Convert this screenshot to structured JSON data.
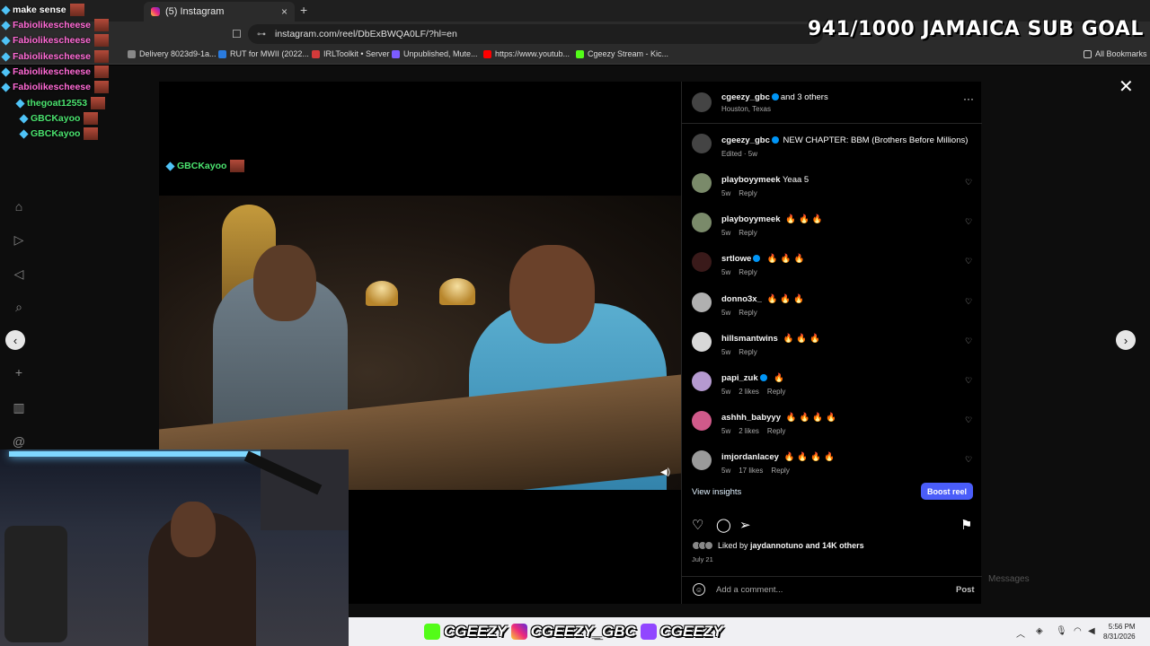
{
  "browser": {
    "tab_title": "(5) Instagram",
    "url": "instagram.com/reel/DbExBWQA0LF/?hl=en",
    "bookmarks": [
      {
        "label": "Delivery 8023d9-1a...",
        "color": "#888888"
      },
      {
        "label": "RUT for MWII (2022...",
        "color": "#2a7bde"
      },
      {
        "label": "IRLToolkit • Server",
        "color": "#d33a3a"
      },
      {
        "label": "Unpublished, Mute...",
        "color": "#7b5cff"
      },
      {
        "label": "https://www.youtub...",
        "color": "#ff0000"
      },
      {
        "label": "Cgeezy Stream - Kic...",
        "color": "#53fc18"
      }
    ],
    "all_bookmarks": "All Bookmarks"
  },
  "stream": {
    "chat": [
      {
        "user": "make sense",
        "color": "#ffffff"
      },
      {
        "user": "Fabiolikescheese",
        "color": "#ff6ad5"
      },
      {
        "user": "Fabiolikescheese",
        "color": "#ff6ad5"
      },
      {
        "user": "Fabiolikescheese",
        "color": "#ff6ad5"
      },
      {
        "user": "Fabiolikescheese",
        "color": "#ff6ad5"
      },
      {
        "user": "Fabiolikescheese",
        "color": "#ff6ad5"
      },
      {
        "user": "thegoat12553",
        "color": "#4be36f"
      },
      {
        "user": "GBCKayoo",
        "color": "#4be36f"
      },
      {
        "user": "GBCKayoo",
        "color": "#4be36f"
      }
    ],
    "video_overlay_user": "GBCKayoo",
    "sub_goal": "941/1000 JAMAICA SUB GOAL",
    "socials": [
      "CGEEZY",
      "CGEEZY_GBC",
      "CGEEZY"
    ],
    "clock_time": "5:56 PM",
    "clock_date": "8/31/2026",
    "ghost_messages": "Messages"
  },
  "post": {
    "owner": "cgeezy_gbc",
    "collab": "and 3 others",
    "location": "Houston, Texas",
    "caption": "NEW CHAPTER: BBM (Brothers Before Millions)",
    "caption_meta": "Edited · 5w",
    "comments": [
      {
        "user": "playboyymeek",
        "text": "Yeaa 5",
        "fires": 0,
        "age": "5w",
        "likes": "",
        "reply": "Reply",
        "verified": false,
        "avatar": "#7a8a6a"
      },
      {
        "user": "playboyymeek",
        "text": "",
        "fires": 3,
        "age": "5w",
        "likes": "",
        "reply": "Reply",
        "verified": false,
        "avatar": "#7a8a6a"
      },
      {
        "user": "srtlowe",
        "text": "",
        "fires": 3,
        "age": "5w",
        "likes": "",
        "reply": "Reply",
        "verified": true,
        "avatar": "#3a1a1a"
      },
      {
        "user": "donno3x_",
        "text": "",
        "fires": 3,
        "age": "5w",
        "likes": "",
        "reply": "Reply",
        "verified": false,
        "avatar": "#b0b0b0"
      },
      {
        "user": "hillsmantwins",
        "text": "",
        "fires": 3,
        "age": "5w",
        "likes": "",
        "reply": "Reply",
        "verified": false,
        "avatar": "#d8d8d8"
      },
      {
        "user": "papi_zuk",
        "text": "",
        "fires": 1,
        "age": "5w",
        "likes": "2 likes",
        "reply": "Reply",
        "verified": true,
        "avatar": "#b59ad0"
      },
      {
        "user": "ashhh_babyyy",
        "text": "",
        "fires": 4,
        "age": "5w",
        "likes": "2 likes",
        "reply": "Reply",
        "verified": false,
        "avatar": "#d05a8a"
      },
      {
        "user": "imjordanlacey",
        "text": "",
        "fires": 4,
        "age": "5w",
        "likes": "17 likes",
        "reply": "Reply",
        "verified": false,
        "avatar": "#9a9a9a"
      }
    ],
    "view_insights": "View insights",
    "boost": "Boost reel",
    "liked_by_prefix": "Liked by",
    "liked_by_user": "jaydannotuno",
    "liked_by_suffix": "and 14K others",
    "date": "July 21",
    "add_comment_placeholder": "Add a comment...",
    "post_label": "Post"
  },
  "icons": {
    "heart": "heart-icon",
    "comment": "comment-icon",
    "share": "share-icon",
    "save": "bookmark-icon",
    "close": "close-icon",
    "more": "more-icon"
  },
  "colors": {
    "boost": "#4a5df9",
    "verified": "#0095f6",
    "sub_goal": "#ffffff"
  }
}
